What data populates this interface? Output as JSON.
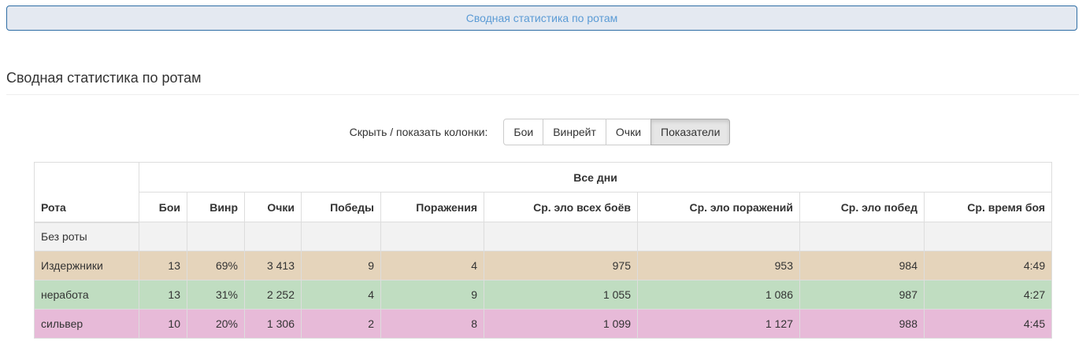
{
  "top_bar": {
    "label": "Сводная статистика по ротам"
  },
  "section": {
    "title": "Сводная статистика по ротам"
  },
  "toggles": {
    "label": "Скрыть / показать колонки:",
    "buttons": [
      {
        "label": "Бои",
        "active": false
      },
      {
        "label": "Винрейт",
        "active": false
      },
      {
        "label": "Очки",
        "active": false
      },
      {
        "label": "Показатели",
        "active": true
      }
    ]
  },
  "table": {
    "group_header": "Все дни",
    "rota_header": "Рота",
    "columns": [
      "Бои",
      "Винр",
      "Очки",
      "Победы",
      "Поражения",
      "Ср. эло всех боёв",
      "Ср. эло поражений",
      "Ср. эло побед",
      "Ср. время боя"
    ],
    "rows": [
      {
        "name": "Без роты",
        "color": "#f2f2f2",
        "cells": [
          "",
          "",
          "",
          "",
          "",
          "",
          "",
          "",
          ""
        ]
      },
      {
        "name": "Издержники",
        "color": "#e5d4bb",
        "cells": [
          "13",
          "69%",
          "3 413",
          "9",
          "4",
          "975",
          "953",
          "984",
          "4:49"
        ]
      },
      {
        "name": "неработа",
        "color": "#c0ddc1",
        "cells": [
          "13",
          "31%",
          "2 252",
          "4",
          "9",
          "1 055",
          "1 086",
          "987",
          "4:27"
        ]
      },
      {
        "name": "сильвер",
        "color": "#e7bad8",
        "cells": [
          "10",
          "20%",
          "1 306",
          "2",
          "8",
          "1 099",
          "1 127",
          "988",
          "4:45"
        ]
      }
    ]
  }
}
